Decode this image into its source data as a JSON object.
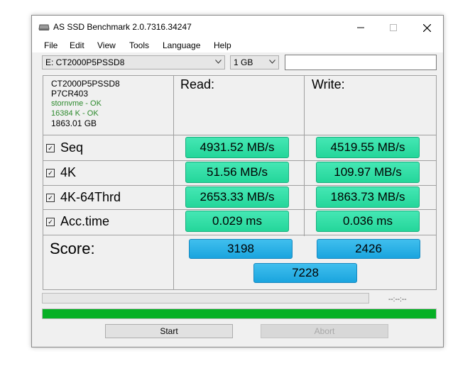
{
  "window": {
    "title": "AS SSD Benchmark 2.0.7316.34247"
  },
  "menu": {
    "items": [
      "File",
      "Edit",
      "View",
      "Tools",
      "Language",
      "Help"
    ]
  },
  "toolbar": {
    "drive": "E: CT2000P5PSSD8",
    "size": "1 GB",
    "info_value": ""
  },
  "drive_info": {
    "model": "CT2000P5PSSD8",
    "firmware": "P7CR403",
    "driver": "stornvme - OK",
    "alignment": "16384 K - OK",
    "capacity": "1863.01 GB"
  },
  "columns": {
    "read": "Read:",
    "write": "Write:"
  },
  "tests": [
    {
      "label": "Seq",
      "checked": true,
      "read": "4931.52 MB/s",
      "write": "4519.55 MB/s"
    },
    {
      "label": "4K",
      "checked": true,
      "read": "51.56 MB/s",
      "write": "109.97 MB/s"
    },
    {
      "label": "4K-64Thrd",
      "checked": true,
      "read": "2653.33 MB/s",
      "write": "1863.73 MB/s"
    },
    {
      "label": "Acc.time",
      "checked": true,
      "read": "0.029 ms",
      "write": "0.036 ms"
    }
  ],
  "score": {
    "label": "Score:",
    "read": "3198",
    "write": "2426",
    "total": "7228"
  },
  "progress": {
    "test_fraction": 0.0,
    "overall_fraction": 1.0,
    "time": "--:--:--"
  },
  "buttons": {
    "start": "Start",
    "abort": "Abort"
  },
  "colors": {
    "result": "#2ddfa6",
    "score": "#29b0e6",
    "progress": "#06b025"
  }
}
